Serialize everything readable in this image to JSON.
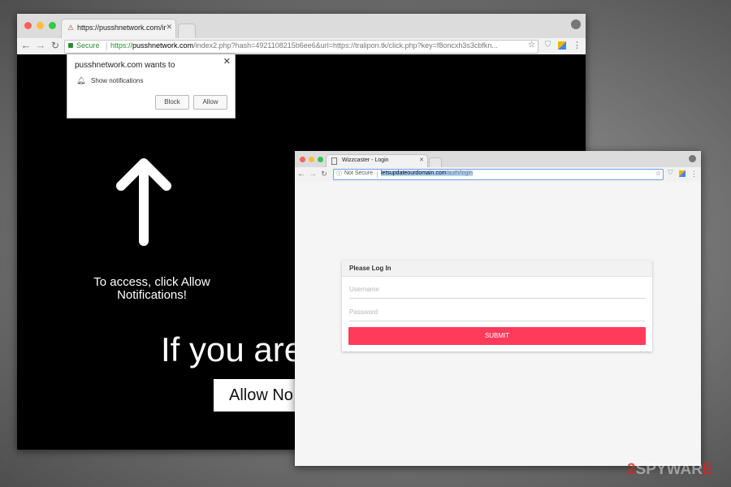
{
  "win1": {
    "tab_title": "https://pusshnetwork.com/ind",
    "secure_label": "Secure",
    "url_scheme": "https://",
    "url_host": "pusshnetwork.com",
    "url_rest": "/index2.php?hash=4921108215b6ee6&url=https://tralipon.tk/click.php?key=f8oncxh3s3cbfkn...",
    "notification": {
      "title": "pusshnetwork.com wants to",
      "permission": "Show notifications",
      "block_label": "Block",
      "allow_label": "Allow"
    },
    "page": {
      "instruction_line1": "To access, click Allow",
      "instruction_line2": "Notifications!",
      "headline": "If you are",
      "button_label": "Allow No"
    }
  },
  "win2": {
    "tab_title": "Wizzcaster - Login",
    "not_secure_label": "Not Secure",
    "url_host": "letsupdateourdomain.com",
    "url_path": "/auth/login",
    "login": {
      "header": "Please Log In",
      "username_placeholder": "Username",
      "password_placeholder": "Password",
      "submit_label": "SUBMIT"
    }
  },
  "watermark": {
    "prefix": "2",
    "text": "SPYWAR",
    "suffix": "E"
  },
  "colors": {
    "secure_green": "#2e8b34",
    "submit_red": "#ff3a5a",
    "url_highlight": "#b3d4fc"
  }
}
